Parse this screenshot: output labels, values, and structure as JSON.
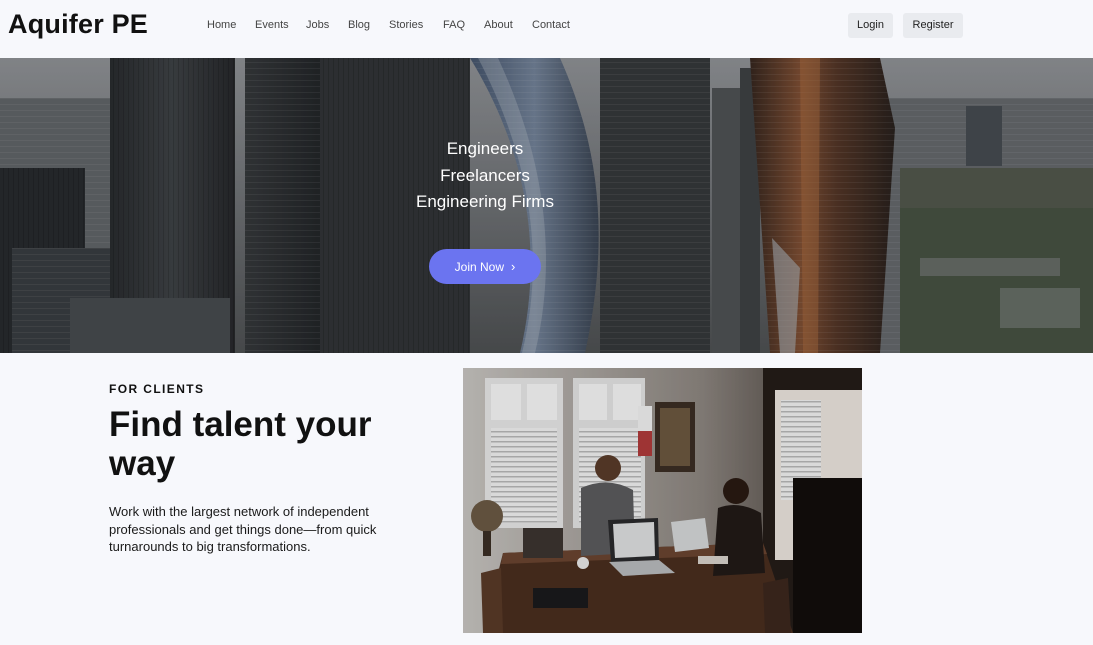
{
  "header": {
    "logo": "Aquifer PE",
    "nav": [
      "Home",
      "Events",
      "Jobs",
      "Blog",
      "Stories",
      "FAQ",
      "About",
      "Contact"
    ],
    "login_label": "Login",
    "register_label": "Register"
  },
  "hero": {
    "lines": [
      "Engineers",
      "Freelancers",
      "Engineering Firms"
    ],
    "cta_label": "Join Now",
    "cta_icon": "chevron-right-icon",
    "accent": "#6b74f0"
  },
  "clients": {
    "eyebrow": "FOR CLIENTS",
    "title": "Find talent your way",
    "description": "Work with the largest network of independent professionals and get things done—from quick turnarounds to big transformations."
  }
}
